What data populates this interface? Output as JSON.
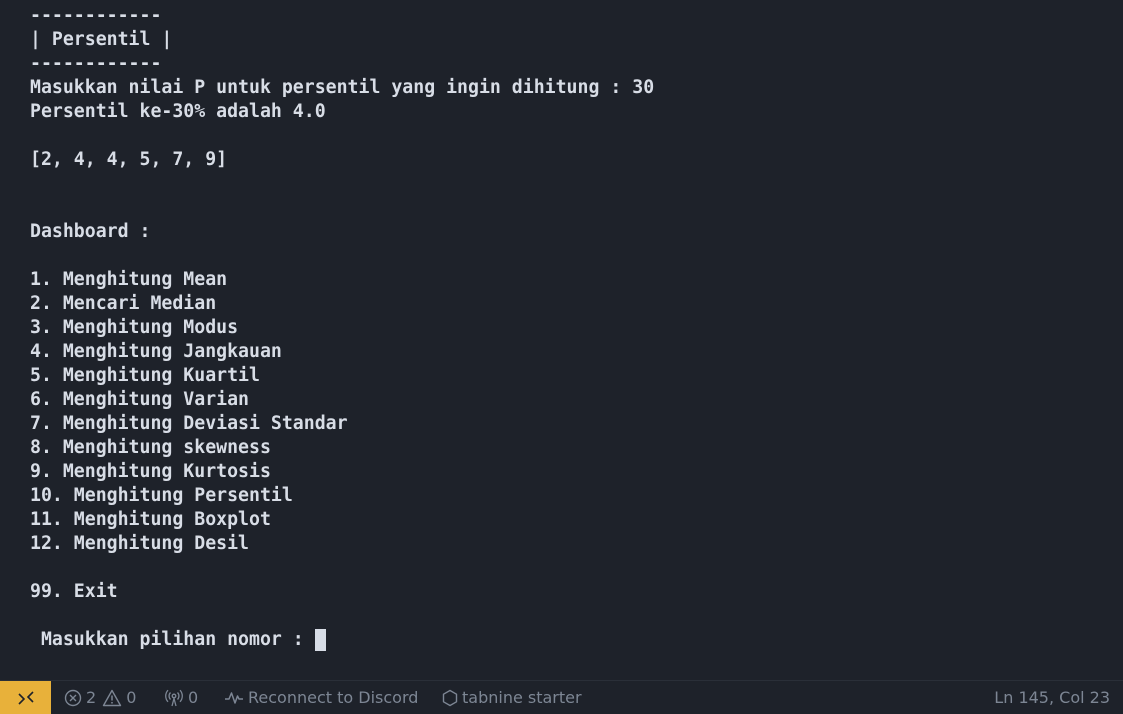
{
  "terminal": {
    "lines": [
      "------------",
      "| Persentil |",
      "------------",
      "Masukkan nilai P untuk persentil yang ingin dihitung : 30",
      "Persentil ke-30% adalah 4.0",
      "",
      "[2, 4, 4, 5, 7, 9]",
      "",
      "",
      "Dashboard :",
      "",
      "1. Menghitung Mean",
      "2. Mencari Median",
      "3. Menghitung Modus",
      "4. Menghitung Jangkauan",
      "5. Menghitung Kuartil",
      "6. Menghitung Varian",
      "7. Menghitung Deviasi Standar",
      "8. Menghitung skewness",
      "9. Menghitung Kurtosis",
      "10. Menghitung Persentil",
      "11. Menghitung Boxplot",
      "12. Menghitung Desil",
      "",
      "99. Exit",
      ""
    ],
    "prompt": " Masukkan pilihan nomor : "
  },
  "statusbar": {
    "remote_icon": "remote-connection-icon",
    "errors_count": "2",
    "warnings_count": "0",
    "ports_count": "0",
    "discord_label": "Reconnect to Discord",
    "tabnine_label": "tabnine starter",
    "cursor_position": "Ln 145, Col 23"
  },
  "colors": {
    "background": "#1e222a",
    "foreground": "#d8dde6",
    "statusbar_text": "#7d8694",
    "remote_accent": "#e8b13a"
  }
}
